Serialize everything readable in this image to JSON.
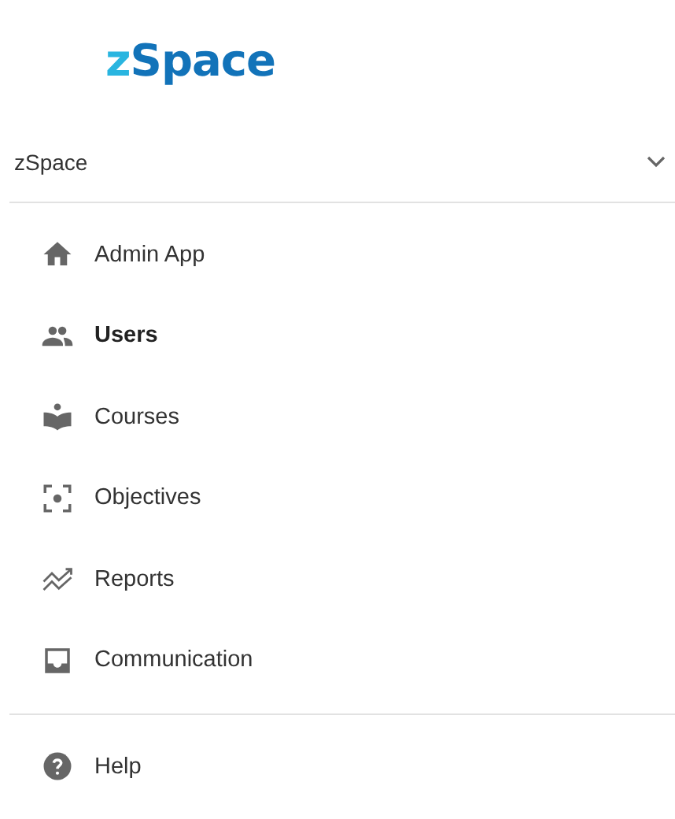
{
  "logo": {
    "prefix": "z",
    "name": "Space"
  },
  "org_select": {
    "value": "zSpace"
  },
  "nav": [
    {
      "kind": "home",
      "label": "Admin App",
      "selected": false
    },
    {
      "kind": "users",
      "label": "Users",
      "selected": true
    },
    {
      "kind": "courses",
      "label": "Courses",
      "selected": false
    },
    {
      "kind": "objectives",
      "label": "Objectives",
      "selected": false
    },
    {
      "kind": "reports",
      "label": "Reports",
      "selected": false
    },
    {
      "kind": "communication",
      "label": "Communication",
      "selected": false
    }
  ],
  "footer_nav": [
    {
      "kind": "help",
      "label": "Help",
      "selected": false
    }
  ]
}
